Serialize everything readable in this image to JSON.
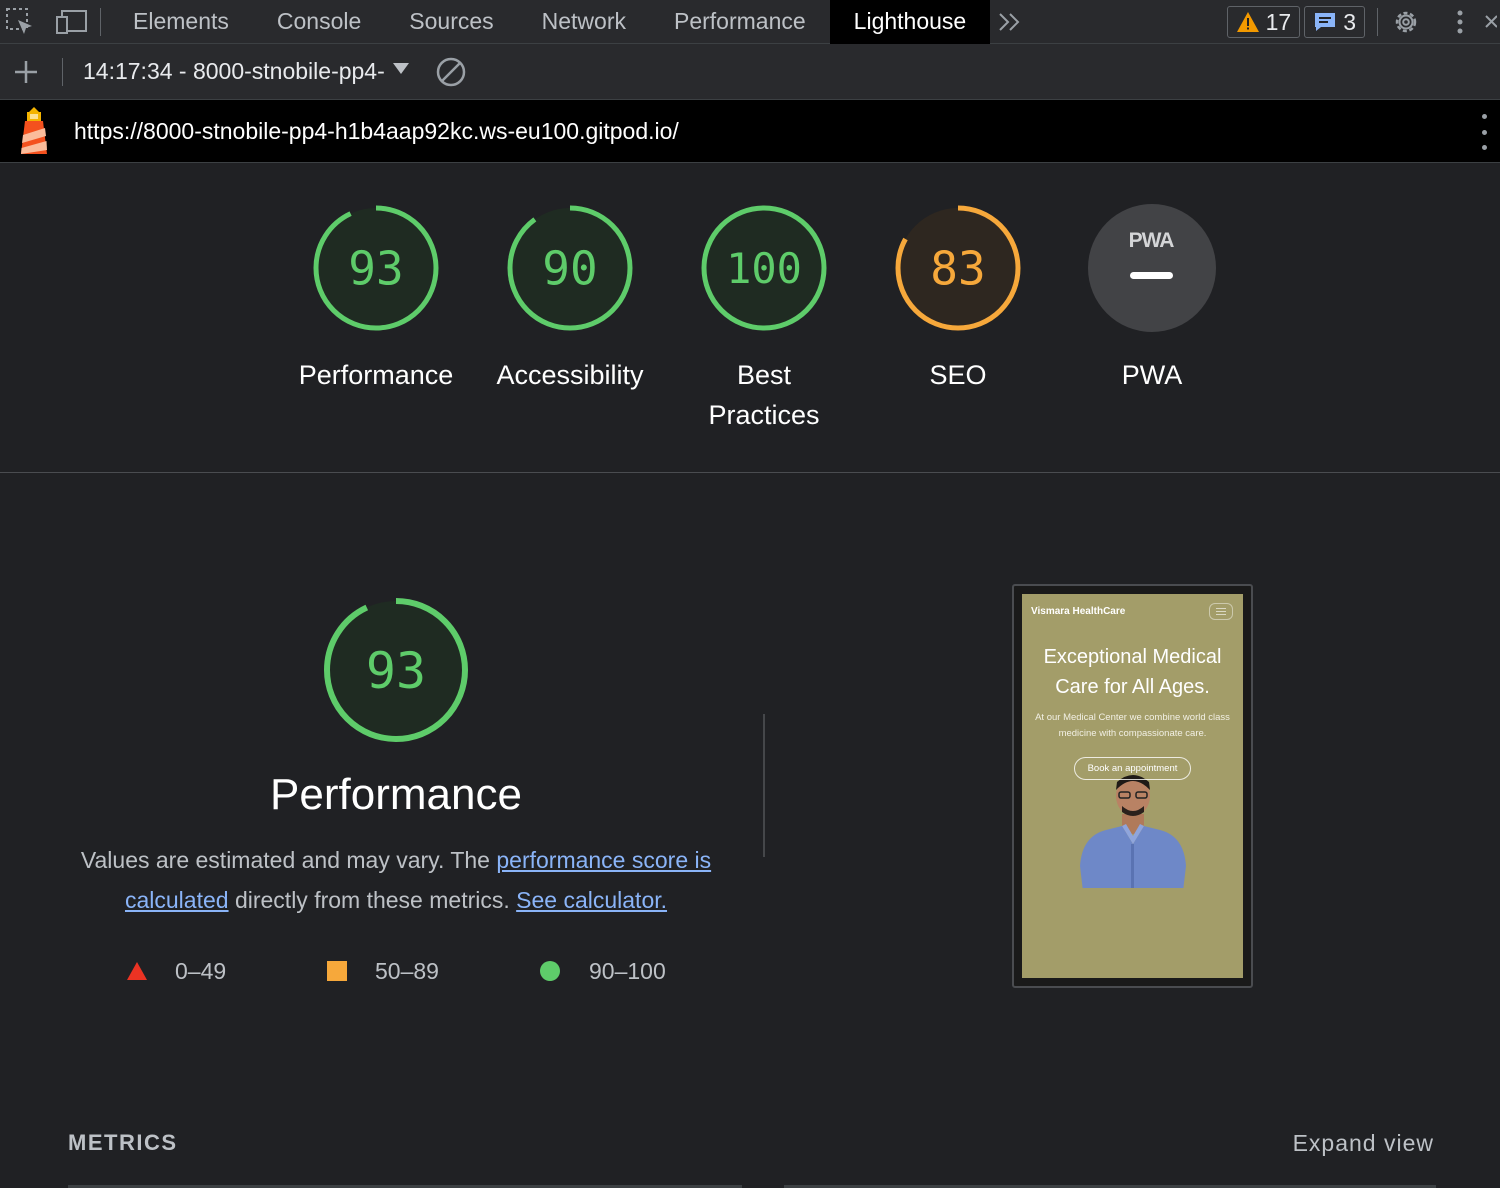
{
  "toolbar": {
    "tabs": [
      "Elements",
      "Console",
      "Sources",
      "Network",
      "Performance",
      "Lighthouse"
    ],
    "active_tab": "Lighthouse",
    "warnings_count": "17",
    "messages_count": "3"
  },
  "report": {
    "selector_label": "14:17:34 - 8000-stnobile-pp4-",
    "url": "https://8000-stnobile-pp4-h1b4aap92kc.ws-eu100.gitpod.io/"
  },
  "categories": [
    {
      "label": "Performance",
      "score": 93,
      "display": "93",
      "rating": "pass"
    },
    {
      "label": "Accessibility",
      "score": 90,
      "display": "90",
      "rating": "pass"
    },
    {
      "label": "Best Practices",
      "score": 100,
      "display": "100",
      "rating": "pass"
    },
    {
      "label": "SEO",
      "score": 83,
      "display": "83",
      "rating": "average"
    },
    {
      "label": "PWA",
      "badge": "PWA",
      "rating": "na"
    }
  ],
  "performance": {
    "score": 93,
    "display": "93",
    "title": "Performance",
    "desc_prefix": "Values are estimated and may vary. The",
    "link_score": "performance score is calculated",
    "desc_middle": "directly from these metrics.",
    "link_calculator": "See calculator."
  },
  "legend": [
    {
      "range": "0–49",
      "shape": "triangle",
      "color": "#eb3323"
    },
    {
      "range": "50–89",
      "shape": "square",
      "color": "#f6a83b"
    },
    {
      "range": "90–100",
      "shape": "circle",
      "color": "#5ecc6a"
    }
  ],
  "screenshot": {
    "brand": "Vismara HealthCare",
    "headline": "Exceptional Medical Care for All Ages.",
    "subtext": "At our Medical Center we combine world class medicine with compassionate care.",
    "cta": "Book an appointment"
  },
  "metrics": {
    "heading": "METRICS",
    "expand_label": "Expand view"
  },
  "colors": {
    "pass": "#5ecc6a",
    "average": "#f6a83b",
    "fail": "#eb3323",
    "pass_fill": "#1f2b22",
    "average_fill": "#2e2720"
  }
}
